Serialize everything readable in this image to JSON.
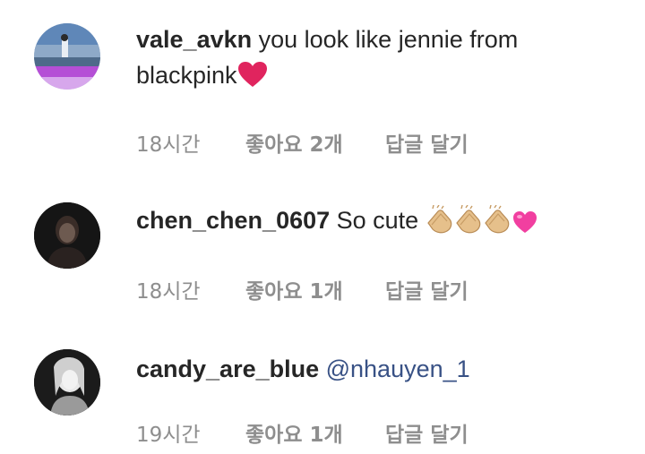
{
  "comments": [
    {
      "username": "vale_avkn",
      "text_line1": " you look like jennie from",
      "text_line2": "blackpink",
      "time": "18시간",
      "likes": "좋아요 2개",
      "reply": "답글 달기",
      "emoji": [
        "heart-icon"
      ]
    },
    {
      "username": "chen_chen_0607",
      "text": " So cute ",
      "time": "18시간",
      "likes": "좋아요 1개",
      "reply": "답글 달기",
      "emoji": [
        "clap-icon",
        "clap-icon",
        "clap-icon",
        "pink-heart-icon"
      ]
    },
    {
      "username": "candy_are_blue",
      "mention": " @nhauyen_1",
      "time": "19시간",
      "likes": "좋아요 1개",
      "reply": "답글 달기"
    }
  ],
  "colors": {
    "text": "#262626",
    "meta": "#8e8e8e",
    "mention": "#385185",
    "heart": "#e0245e"
  }
}
